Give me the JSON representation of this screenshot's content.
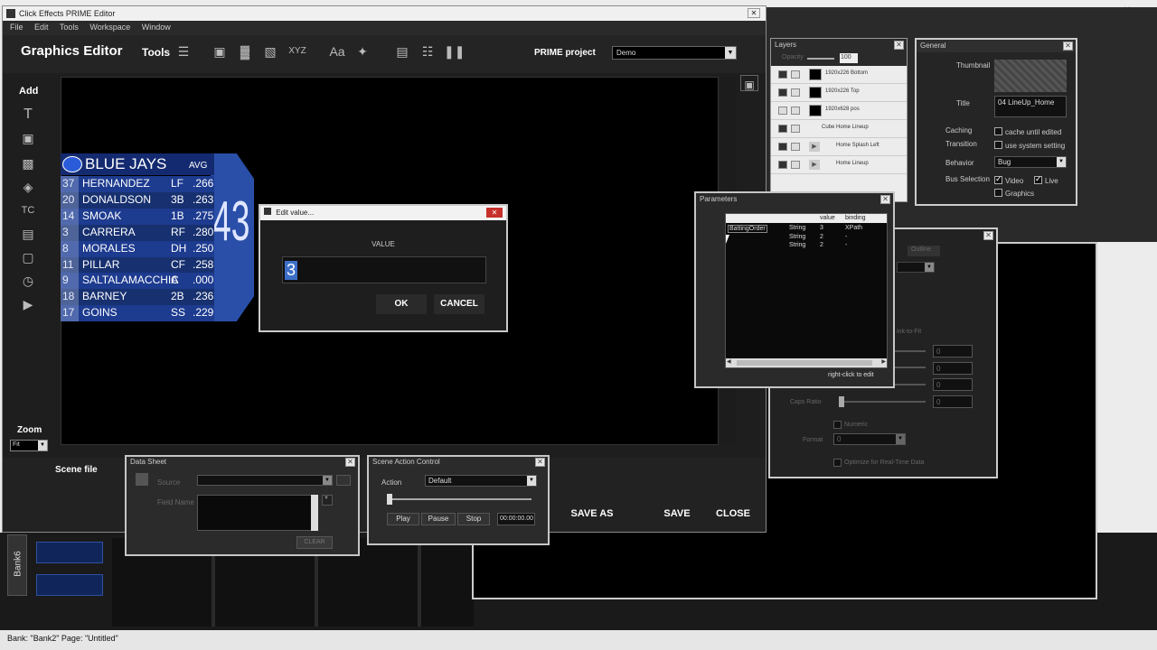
{
  "main_window": {
    "title": "Click Effects PRIME Editor",
    "menu": [
      "File",
      "Edit",
      "Tools",
      "Workspace",
      "Window"
    ],
    "heading": "Graphics Editor",
    "tools_label": "Tools",
    "project_label": "PRIME project",
    "project_value": "Demo",
    "add_label": "Add",
    "zoom_label": "Zoom",
    "zoom_value": "Fit",
    "scene_file_label": "Scene file",
    "save_as": "SAVE AS",
    "save": "SAVE",
    "close": "CLOSE"
  },
  "roster": {
    "team": "BLUE JAYS",
    "avg_header": "AVG",
    "big_number": "43",
    "rows": [
      {
        "num": "37",
        "name": "HERNANDEZ",
        "pos": "LF",
        "avg": ".266"
      },
      {
        "num": "20",
        "name": "DONALDSON",
        "pos": "3B",
        "avg": ".263"
      },
      {
        "num": "14",
        "name": "SMOAK",
        "pos": "1B",
        "avg": ".275"
      },
      {
        "num": "3",
        "name": "CARRERA",
        "pos": "RF",
        "avg": ".280"
      },
      {
        "num": "8",
        "name": "MORALES",
        "pos": "DH",
        "avg": ".250"
      },
      {
        "num": "11",
        "name": "PILLAR",
        "pos": "CF",
        "avg": ".258"
      },
      {
        "num": "9",
        "name": "SALTALAMACCHIA",
        "pos": "C",
        "avg": ".000"
      },
      {
        "num": "18",
        "name": "BARNEY",
        "pos": "2B",
        "avg": ".236"
      },
      {
        "num": "17",
        "name": "GOINS",
        "pos": "SS",
        "avg": ".229"
      }
    ]
  },
  "edit_dialog": {
    "title": "Edit value...",
    "label": "VALUE",
    "value": "3",
    "ok": "OK",
    "cancel": "CANCEL"
  },
  "layers": {
    "title": "Layers",
    "opacity_label": "Opacity",
    "opacity_value": "100",
    "items": [
      "1920x226 Bottom",
      "1920x226 Top",
      "1920x628 pos",
      "Cube Home Lineup",
      "Home Splash Left",
      "Home Lineup"
    ]
  },
  "general": {
    "title": "General",
    "thumbnail_label": "Thumbnail",
    "title_label": "Title",
    "title_value": "04 LineUp_Home",
    "caching_label": "Caching",
    "caching_option": "cache until edited",
    "transition_label": "Transition",
    "transition_option": "use system setting",
    "behavior_label": "Behavior",
    "behavior_value": "Bug",
    "bus_label": "Bus Selection",
    "bus_video": "Video",
    "bus_live": "Live",
    "bus_graphics": "Graphics"
  },
  "parameters": {
    "title": "Parameters",
    "headers": [
      "",
      "",
      "value",
      "binding"
    ],
    "rows": [
      {
        "name": "BattingOrder",
        "type": "String",
        "value": "3",
        "binding": "XPath"
      },
      {
        "name": "",
        "type": "String",
        "value": "2",
        "binding": "-"
      },
      {
        "name": "",
        "type": "String",
        "value": "2",
        "binding": "-"
      }
    ],
    "hint": "right-click to edit"
  },
  "behind_panel": {
    "tab": "Outline",
    "fit_label": "ink-to-Fit",
    "caps_label": "Caps Ratio",
    "numeric_label": "Numeric",
    "format_label": "Format",
    "format_value": "0",
    "optimize_label": "Optimize for Real-Time Data",
    "field_values": [
      "0",
      "0",
      "0",
      "0"
    ]
  },
  "data_sheet": {
    "title": "Data Sheet",
    "source_label": "Source",
    "field_name_label": "Field Name",
    "clear": "CLEAR"
  },
  "scene_action": {
    "title": "Scene Action Control",
    "action_label": "Action",
    "action_value": "Default",
    "play": "Play",
    "pause": "Pause",
    "stop": "Stop",
    "timecode": "00:00:00.00"
  },
  "bank_tab": "Bank6",
  "status_bar": "Bank: \"Bank2\"   Page: \"Untitled\""
}
